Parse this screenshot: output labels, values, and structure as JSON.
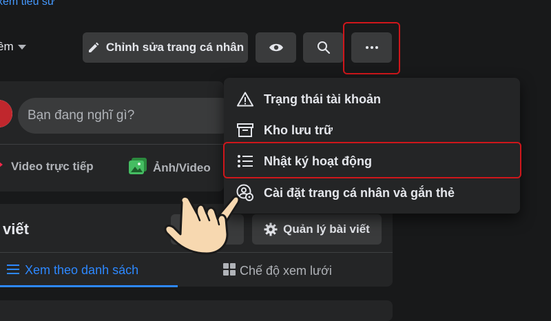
{
  "header": {
    "top_link": "xem tiểu sử",
    "filter_label": "ềm"
  },
  "toolbar": {
    "edit_profile_label": "Chỉnh sửa trang cá nhân"
  },
  "composer": {
    "placeholder": "Bạn đang nghĩ gì?",
    "live_video_label": "Video trực tiếp",
    "photo_video_label": "Ảnh/Video"
  },
  "dropdown_menu": {
    "items": [
      {
        "label": "Trạng thái tài khoản",
        "icon": "warning-triangle-icon"
      },
      {
        "label": "Kho lưu trữ",
        "icon": "archive-box-icon"
      },
      {
        "label": "Nhật ký hoạt động",
        "icon": "list-icon",
        "highlighted": true
      },
      {
        "label": "Cài đặt trang cá nhân và gắn thẻ",
        "icon": "profile-settings-icon"
      }
    ]
  },
  "posts": {
    "title": "viết",
    "manage_posts_label": "Quản lý bài viết",
    "view_list_label": "Xem theo danh sách",
    "view_grid_label": "Chế độ xem lưới"
  },
  "colors": {
    "highlight": "#d0161b",
    "accent": "#2d88ff",
    "background": "#18191a",
    "card": "#242526"
  }
}
